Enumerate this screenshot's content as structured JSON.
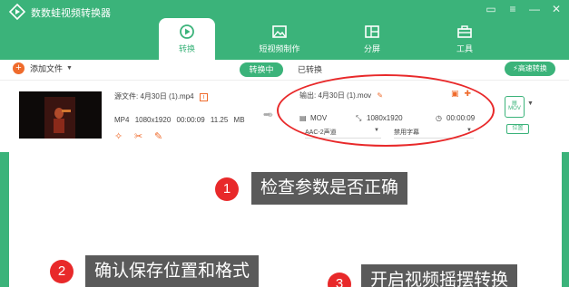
{
  "app": {
    "title": "数数蛙视频转换器"
  },
  "window": {
    "controls": [
      "comment-icon",
      "menu-icon",
      "minimize-icon",
      "close-icon"
    ]
  },
  "tabs": [
    {
      "label": "转换",
      "icon": "convert-icon",
      "active": true
    },
    {
      "label": "短视频制作",
      "icon": "image-icon",
      "active": false
    },
    {
      "label": "分屏",
      "icon": "split-screen-icon",
      "active": false
    },
    {
      "label": "工具",
      "icon": "toolbox-icon",
      "active": false
    }
  ],
  "toolbar": {
    "add_file_label": "添加文件",
    "converting_label": "转换中",
    "converted_label": "已转换",
    "fast_convert_label": "高速转换"
  },
  "file": {
    "source_label": "源文件:",
    "source_name": "4月30日 (1).mp4",
    "format": "MP4",
    "resolution": "1080x1920",
    "duration": "00:00:09",
    "size": "11.25 MB",
    "output_label": "输出:",
    "output_name": "4月30日 (1).mov",
    "out_format": "MOV",
    "out_resolution": "1080x1920",
    "out_duration": "00:00:09",
    "audio_option": "AAC-2声道",
    "subtitle_option": "禁用字幕",
    "location_label": "位置"
  },
  "steps": [
    {
      "num": "1",
      "text": "检查参数是否正确"
    },
    {
      "num": "2",
      "text": "确认保存位置和格式"
    },
    {
      "num": "3",
      "text": "开启视频摇摆转换"
    }
  ],
  "colors": {
    "brand_green": "#3bb37a",
    "accent_orange": "#ef6b2c",
    "annotation_red": "#e8292a"
  }
}
